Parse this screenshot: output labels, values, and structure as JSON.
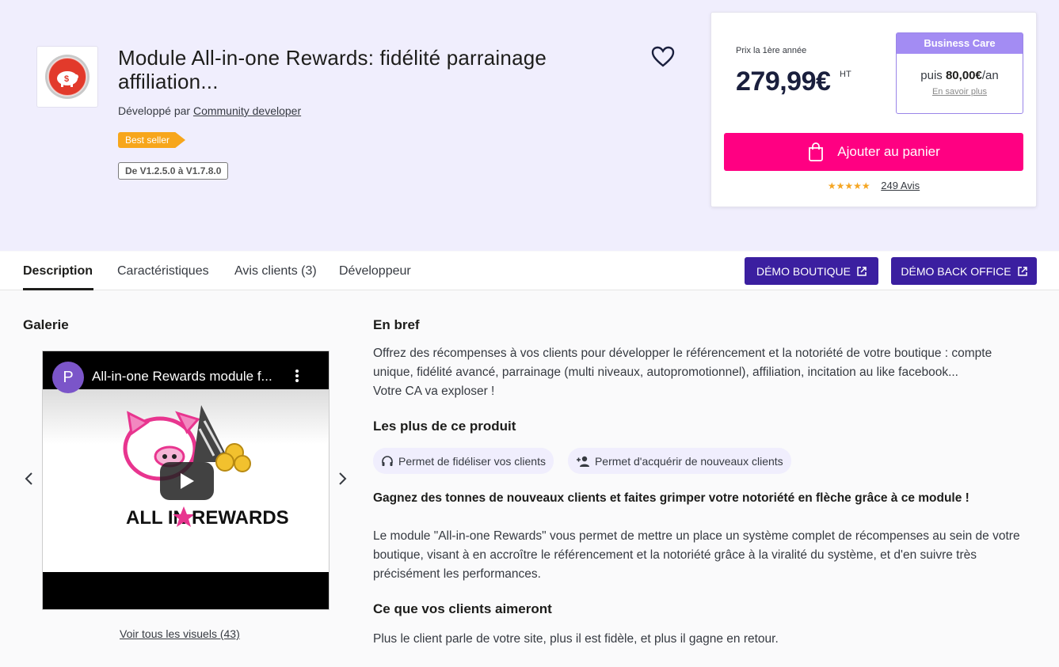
{
  "product": {
    "title": "Module All-in-one Rewards: fidélité parrainage affiliation...",
    "developed_by_prefix": "Développé par",
    "developer": "Community developer",
    "badge": "Best seller",
    "version": "De V1.2.5.0 à V1.7.8.0"
  },
  "price_card": {
    "price_label": "Prix la 1ère année",
    "price": "279,99€",
    "price_suffix": "HT",
    "business_care": {
      "title": "Business Care",
      "then_prefix": "puis",
      "amount": "80,00€",
      "period": "/an",
      "learn_more": "En savoir plus"
    },
    "cart_button": "Ajouter au panier",
    "stars": "★★★★★",
    "reviews": "249 Avis"
  },
  "tabs": [
    "Description",
    "Caractéristiques",
    "Avis clients (3)",
    "Développeur"
  ],
  "demo_buttons": {
    "shop": "DÉMO BOUTIQUE",
    "back_office": "DÉMO BACK OFFICE"
  },
  "gallery": {
    "heading": "Galerie",
    "video_avatar": "P",
    "video_title": "All-in-one Rewards module f...",
    "video_logo_text": "ALL IN",
    "video_logo_text_2": "REWARDS",
    "see_all": "Voir tous les visuels (43)"
  },
  "content": {
    "brief_heading": "En bref",
    "brief_text": "Offrez des récompenses à vos clients pour développer le référencement et la notoriété de votre boutique : compte unique, fidélité avancé, parrainage (multi niveaux, autopromotionnel), affiliation, incitation au like facebook...",
    "brief_text_2": "Votre CA va exploser !",
    "plus_heading": "Les plus de ce produit",
    "plus_items": [
      "Permet de fidéliser vos clients",
      "Permet d'acquérir de nouveaux clients"
    ],
    "bold_line": "Gagnez des tonnes de nouveaux clients et faites grimper votre notoriété en flèche grâce à ce module !",
    "paragraph": "Le module \"All-in-one Rewards\" vous permet de mettre un place un système complet de récompenses au sein de votre boutique, visant à en accroître le référencement et la notoriété grâce à la viralité du système, et d'en suivre très précisément les performances.",
    "clients_heading": "Ce que vos clients aimeront",
    "clients_text": "Plus le client parle de votre site, plus il est fidèle, et plus il gagne en retour."
  },
  "colors": {
    "hero_bg": "#f0eefd",
    "cart": "#ff0082",
    "demo": "#3b1fa0",
    "business_care": "#a38cf3",
    "best_seller": "#f7a61b"
  }
}
